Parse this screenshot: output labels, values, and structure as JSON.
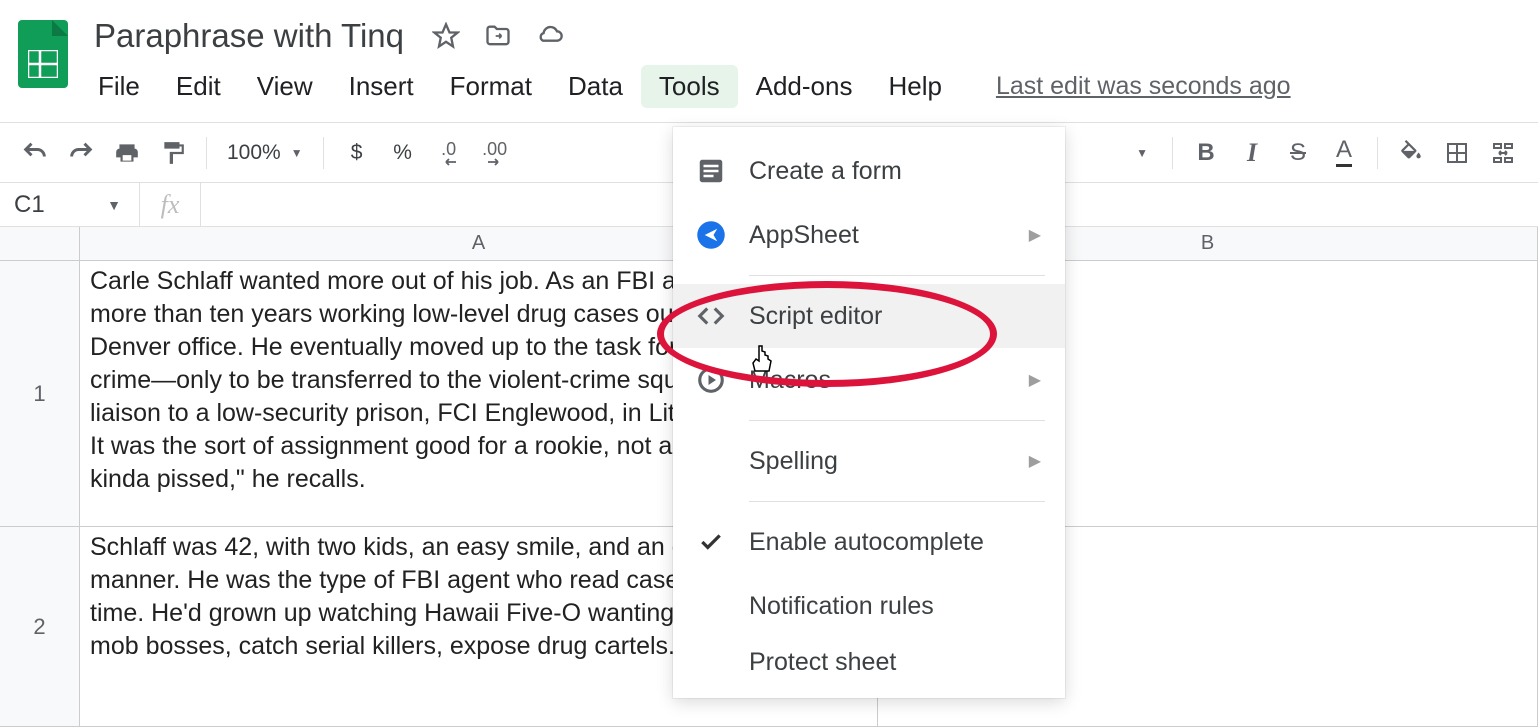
{
  "doc_title": "Paraphrase with Tinq",
  "menus": {
    "file": "File",
    "edit": "Edit",
    "view": "View",
    "insert": "Insert",
    "format": "Format",
    "data": "Data",
    "tools": "Tools",
    "addons": "Add-ons",
    "help": "Help"
  },
  "last_edit": "Last edit was seconds ago",
  "toolbar": {
    "zoom": "100%",
    "currency": "$",
    "percent": "%",
    "dec_dec": ".0",
    "dec_inc": ".00",
    "bold": "B",
    "italic": "I",
    "strike": "S",
    "text_color": "A"
  },
  "cell_ref": "C1",
  "columns": [
    "A",
    "B"
  ],
  "rows": [
    {
      "num": "1",
      "a": "Carle Schlaff wanted more out of his job. As an FBI agent, he'd spent more than ten years working low-level drug cases out of the bureau's Denver office. He eventually moved up to the task force on organized crime—only to be transferred to the violent-crime squad and made the liaison to a low-security prison, FCI Englewood, in Littleton, Colorado. It was the sort of assignment good for a rookie, not a veteran. \"I was kinda pissed,\" he recalls."
    },
    {
      "num": "2",
      "a": "Schlaff was 42, with two kids, an easy smile, and an easygoing manner. He was the type of FBI agent who read case files in his spare time. He'd grown up watching Hawaii Five-O wanting to take down mob bosses, catch serial killers, expose drug cartels."
    }
  ],
  "tools_menu": {
    "create_form": "Create a form",
    "appsheet": "AppSheet",
    "script_editor": "Script editor",
    "macros": "Macros",
    "spelling": "Spelling",
    "autocomplete": "Enable autocomplete",
    "notification_rules": "Notification rules",
    "protect_sheet": "Protect sheet"
  }
}
